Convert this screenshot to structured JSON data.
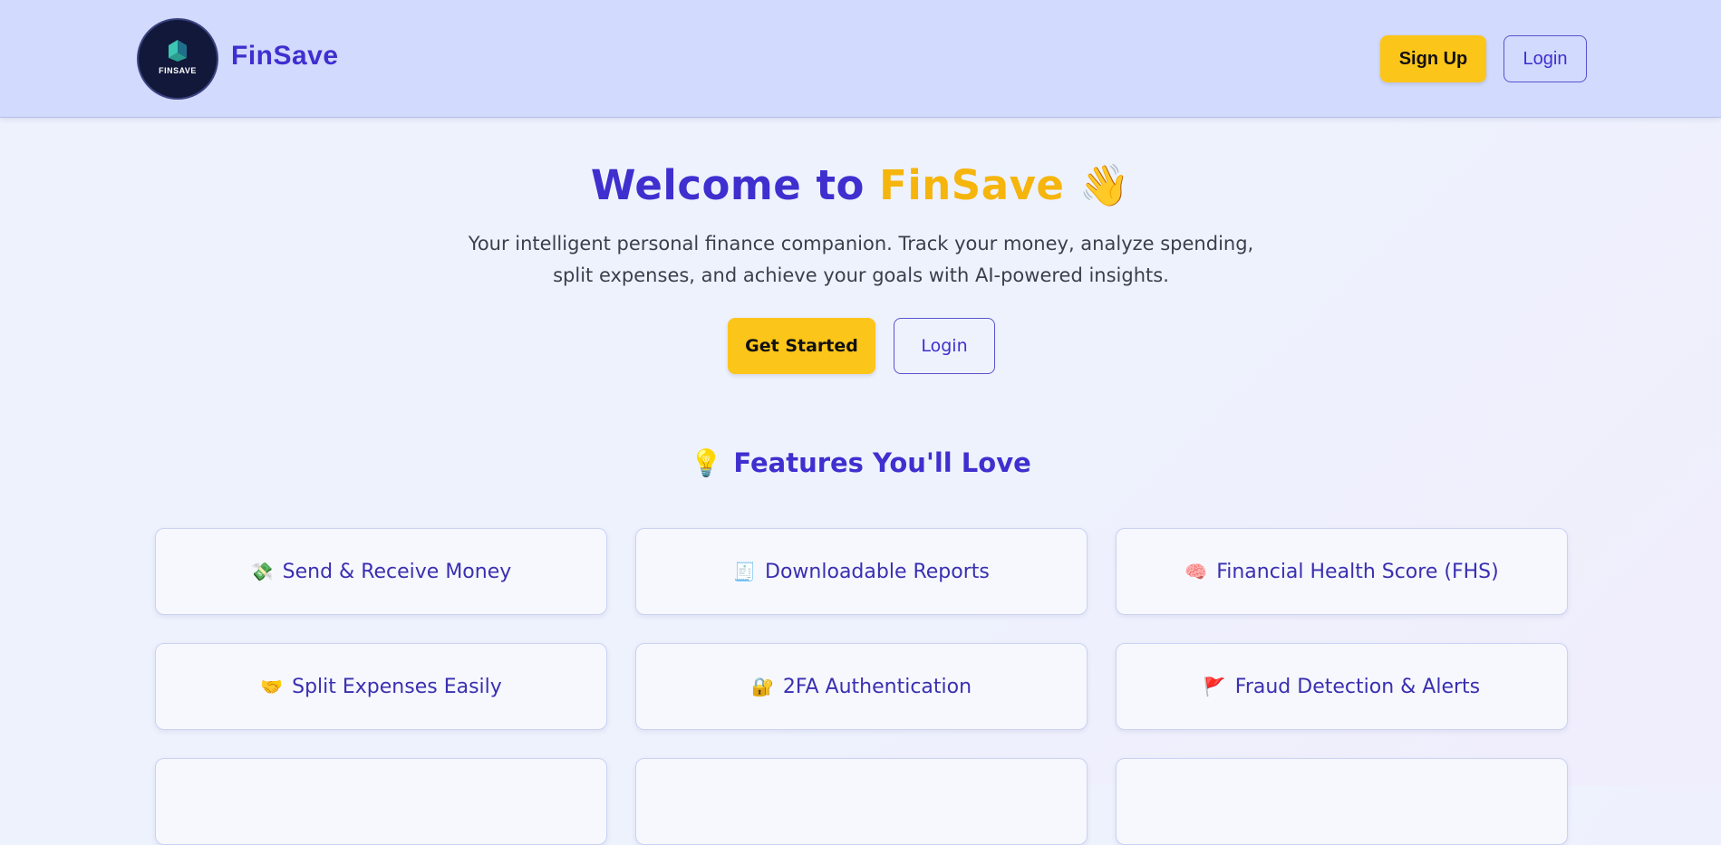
{
  "navbar": {
    "logo_text": "FINSAVE",
    "brand": "FinSave",
    "signup_label": "Sign Up",
    "login_label": "Login"
  },
  "hero": {
    "title_prefix": "Welcome to ",
    "title_accent": "FinSave",
    "title_emoji": "👋",
    "subtitle": "Your intelligent personal finance companion. Track your money, analyze spending, split expenses, and achieve your goals with AI-powered insights.",
    "get_started_label": "Get Started",
    "login_label": "Login"
  },
  "features": {
    "icon": "💡",
    "title": "Features You'll Love",
    "items": [
      {
        "icon": "💸",
        "label": "Send & Receive Money"
      },
      {
        "icon": "🧾",
        "label": "Downloadable Reports"
      },
      {
        "icon": "🧠",
        "label": "Financial Health Score (FHS)"
      },
      {
        "icon": "🤝",
        "label": "Split Expenses Easily"
      },
      {
        "icon": "🔐",
        "label": "2FA Authentication"
      },
      {
        "icon": "🚩",
        "label": "Fraud Detection & Alerts"
      },
      {
        "icon": "",
        "label": ""
      },
      {
        "icon": "",
        "label": ""
      },
      {
        "icon": "",
        "label": ""
      }
    ]
  },
  "colors": {
    "brand_purple": "#3f2fcf",
    "accent_yellow": "#fcc51a",
    "navbar_bg": "#d2dafd"
  }
}
